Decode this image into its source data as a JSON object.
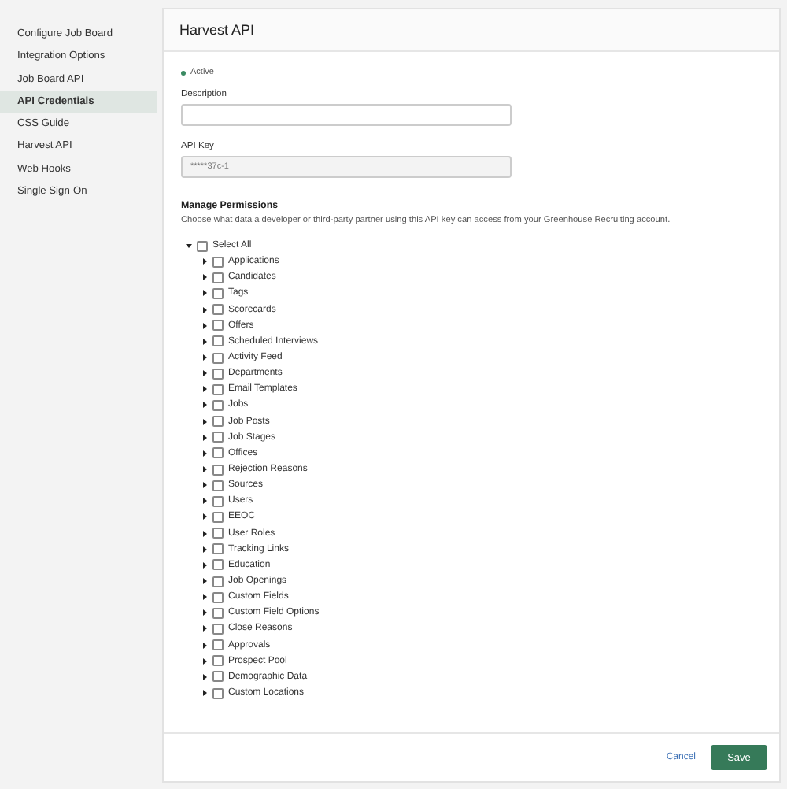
{
  "sidebar": {
    "items": [
      {
        "label": "Configure Job Board",
        "selected": false
      },
      {
        "label": "Integration Options",
        "selected": false
      },
      {
        "label": "Job Board API",
        "selected": false
      },
      {
        "label": "API Credentials",
        "selected": true
      },
      {
        "label": "CSS Guide",
        "selected": false
      },
      {
        "label": "Harvest API",
        "selected": false
      },
      {
        "label": "Web Hooks",
        "selected": false
      },
      {
        "label": "Single Sign-On",
        "selected": false
      }
    ]
  },
  "panel": {
    "title": "Harvest API",
    "status": {
      "label": "Active",
      "color": "#3a8a62"
    },
    "description": {
      "label": "Description"
    },
    "api_key": {
      "label": "API Key",
      "value": "*****37c-1",
      "disabled": true
    },
    "permissions": {
      "heading": "Manage Permissions",
      "help": "Choose what data a developer or third-party partner using this API key can access from your Greenhouse Recruiting account.",
      "tree": [
        {
          "label": "Select All",
          "checked": false,
          "expanded": true,
          "children": [
            {
              "label": "Applications",
              "checked": false,
              "expanded": false
            },
            {
              "label": "Candidates",
              "checked": false,
              "expanded": false
            },
            {
              "label": "Tags",
              "checked": false,
              "expanded": false
            },
            {
              "label": "Scorecards",
              "checked": false,
              "expanded": false
            },
            {
              "label": "Offers",
              "checked": false,
              "expanded": false
            },
            {
              "label": "Scheduled Interviews",
              "checked": false,
              "expanded": false
            },
            {
              "label": "Activity Feed",
              "checked": false,
              "expanded": false
            },
            {
              "label": "Departments",
              "checked": false,
              "expanded": false
            },
            {
              "label": "Email Templates",
              "checked": false,
              "expanded": false
            },
            {
              "label": "Jobs",
              "checked": false,
              "expanded": false
            },
            {
              "label": "Job Posts",
              "checked": false,
              "expanded": false
            },
            {
              "label": "Job Stages",
              "checked": false,
              "expanded": false
            },
            {
              "label": "Offices",
              "checked": false,
              "expanded": false
            },
            {
              "label": "Rejection Reasons",
              "checked": false,
              "expanded": false
            },
            {
              "label": "Sources",
              "checked": false,
              "expanded": false
            },
            {
              "label": "Users",
              "checked": false,
              "expanded": false
            },
            {
              "label": "EEOC",
              "checked": false,
              "expanded": false
            },
            {
              "label": "User Roles",
              "checked": false,
              "expanded": false
            },
            {
              "label": "Tracking Links",
              "checked": false,
              "expanded": false
            },
            {
              "label": "Education",
              "checked": false,
              "expanded": false
            },
            {
              "label": "Job Openings",
              "checked": false,
              "expanded": false
            },
            {
              "label": "Custom Fields",
              "checked": false,
              "expanded": false
            },
            {
              "label": "Custom Field Options",
              "checked": false,
              "expanded": false
            },
            {
              "label": "Close Reasons",
              "checked": false,
              "expanded": false
            },
            {
              "label": "Approvals",
              "checked": false,
              "expanded": false
            },
            {
              "label": "Prospect Pool",
              "checked": false,
              "expanded": false
            },
            {
              "label": "Demographic Data",
              "checked": false,
              "expanded": false
            },
            {
              "label": "Custom Locations",
              "checked": false,
              "expanded": false
            }
          ]
        }
      ]
    }
  },
  "footer": {
    "cancel": "Cancel",
    "save": "Save"
  }
}
